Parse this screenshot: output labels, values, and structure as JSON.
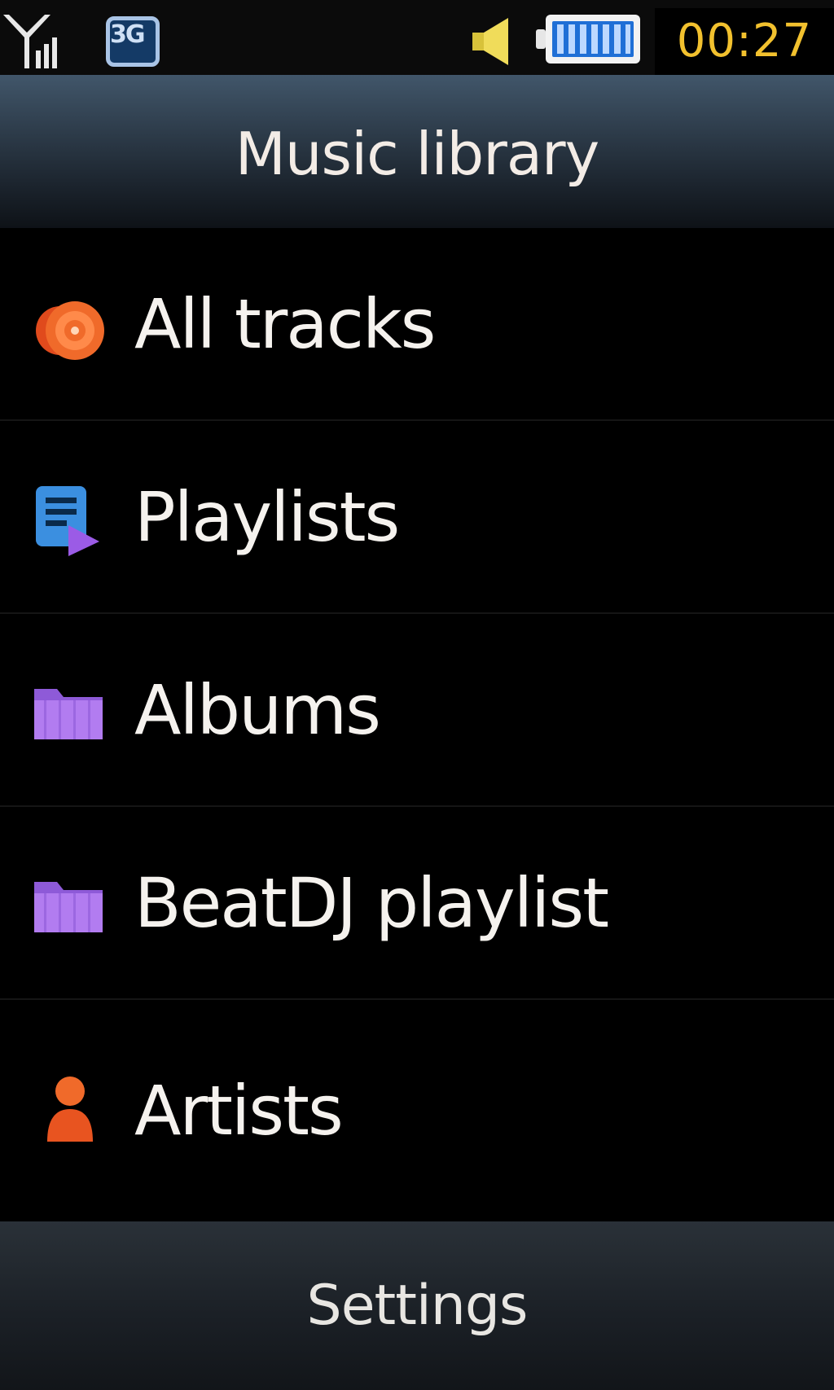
{
  "status_bar": {
    "network_type": "3G",
    "time": "00:27",
    "icons": [
      "signal-icon",
      "network-3g-icon",
      "volume-icon",
      "battery-icon"
    ]
  },
  "header": {
    "title": "Music library"
  },
  "menu": {
    "items": [
      {
        "label": "All tracks",
        "icon": "disc-icon",
        "icon_color": "#f06a2a"
      },
      {
        "label": "Playlists",
        "icon": "playlist-icon",
        "icon_color": "#3b8fe0"
      },
      {
        "label": "Albums",
        "icon": "folder-icon",
        "icon_color": "#a06ae8"
      },
      {
        "label": "BeatDJ playlist",
        "icon": "folder-icon",
        "icon_color": "#a06ae8"
      },
      {
        "label": "Artists",
        "icon": "person-icon",
        "icon_color": "#f06a2a"
      }
    ]
  },
  "footer": {
    "settings_label": "Settings"
  },
  "colors": {
    "clock_text": "#f2c12e",
    "background": "#000000",
    "header_gradient_top": "#41566a",
    "header_gradient_bottom": "#0e1217"
  }
}
